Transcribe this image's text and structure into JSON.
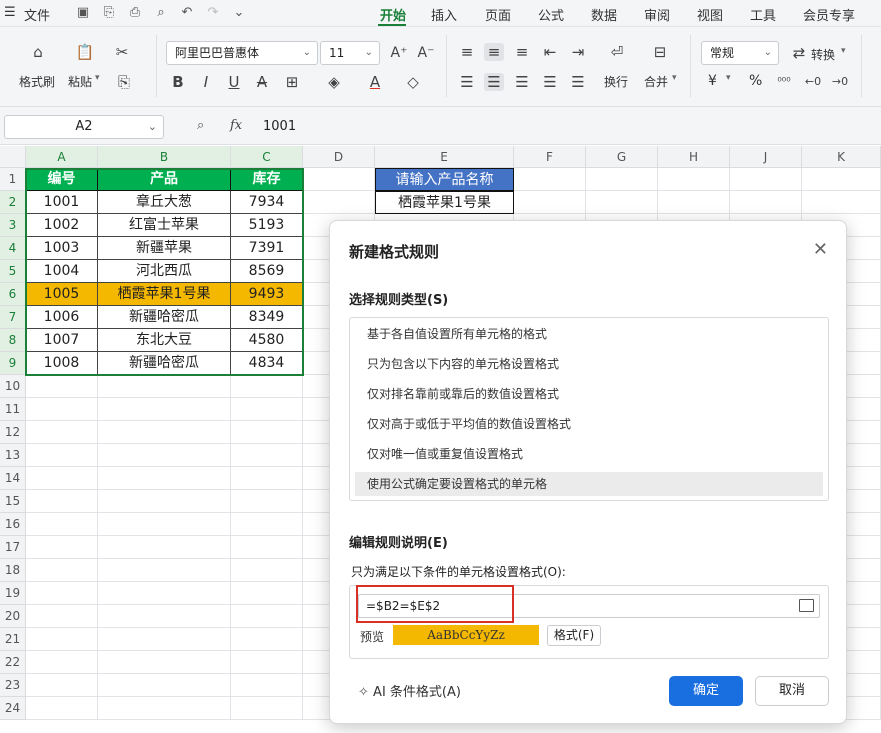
{
  "menubar": {
    "file": "文件",
    "tabs": [
      {
        "label": "开始",
        "active": true
      },
      {
        "label": "插入"
      },
      {
        "label": "页面"
      },
      {
        "label": "公式"
      },
      {
        "label": "数据"
      },
      {
        "label": "审阅"
      },
      {
        "label": "视图"
      },
      {
        "label": "工具"
      },
      {
        "label": "会员专享"
      }
    ]
  },
  "ribbon": {
    "format_painter": "格式刷",
    "paste": "粘贴",
    "font_name": "阿里巴巴普惠体",
    "font_size": "11",
    "wrap": "换行",
    "merge": "合并",
    "number_format": "常规",
    "convert": "转换",
    "currency": "¥",
    "percent": "%"
  },
  "formula_bar": {
    "name_box": "A2",
    "fx": "fx",
    "content": "1001"
  },
  "grid": {
    "columns": [
      "A",
      "B",
      "C",
      "D",
      "E",
      "F",
      "G",
      "H",
      "J",
      "K"
    ],
    "rows": [
      "1",
      "2",
      "3",
      "4",
      "5",
      "6",
      "7",
      "8",
      "9",
      "10",
      "11",
      "12",
      "13",
      "14",
      "15",
      "16",
      "17",
      "18",
      "19",
      "20",
      "21",
      "22",
      "23",
      "24"
    ],
    "headers": [
      "编号",
      "产品",
      "库存"
    ],
    "data": [
      [
        "1001",
        "章丘大葱",
        "7934"
      ],
      [
        "1002",
        "红富士苹果",
        "5193"
      ],
      [
        "1003",
        "新疆苹果",
        "7391"
      ],
      [
        "1004",
        "河北西瓜",
        "8569"
      ],
      [
        "1005",
        "栖霞苹果1号果",
        "9493"
      ],
      [
        "1006",
        "新疆哈密瓜",
        "8349"
      ],
      [
        "1007",
        "东北大豆",
        "4580"
      ],
      [
        "1008",
        "新疆哈密瓜",
        "4834"
      ]
    ],
    "highlight_row_index": 4,
    "e_header": "请输入产品名称",
    "e_value": "栖霞苹果1号果"
  },
  "dialog": {
    "title": "新建格式规则",
    "select_type_label": "选择规则类型(S)",
    "rule_types": [
      "基于各自值设置所有单元格的格式",
      "只为包含以下内容的单元格设置格式",
      "仅对排名靠前或靠后的数值设置格式",
      "仅对高于或低于平均值的数值设置格式",
      "仅对唯一值或重复值设置格式",
      "使用公式确定要设置格式的单元格"
    ],
    "selected_rule_index": 5,
    "edit_label": "编辑规则说明(E)",
    "condition_label": "只为满足以下条件的单元格设置格式(O):",
    "formula": "=$B2=$E$2",
    "preview_label": "预览",
    "preview_text": "AaBbCcYyZz",
    "format_button": "格式(F)",
    "ai_label": "AI 条件格式(A)",
    "ok": "确定",
    "cancel": "取消"
  },
  "colors": {
    "header_green": "#00b050",
    "highlight": "#f5b800",
    "e_header_blue": "#4472c4",
    "ok_blue": "#1a6fe0",
    "accent_green": "#1a7f37"
  }
}
